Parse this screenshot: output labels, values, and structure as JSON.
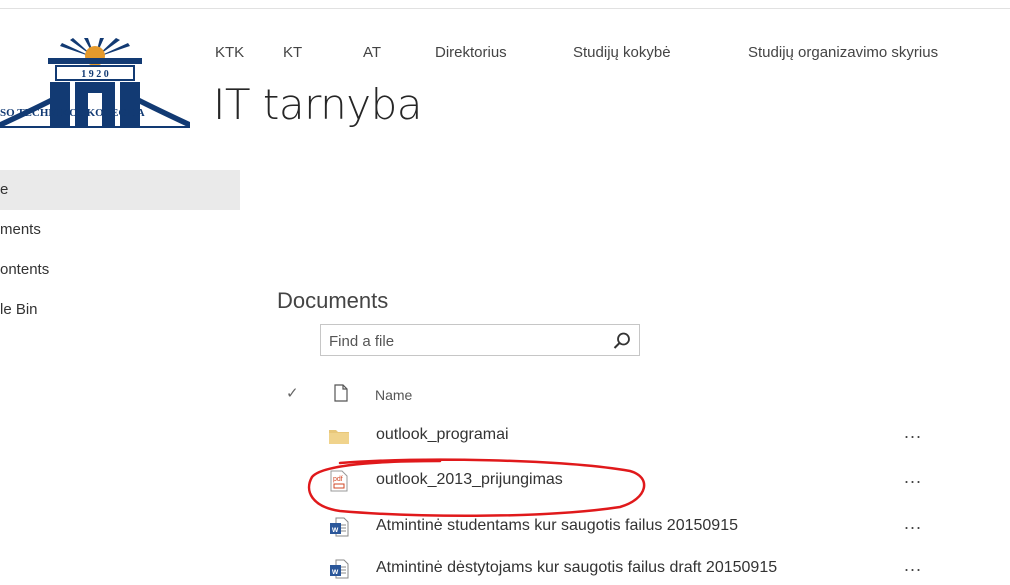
{
  "logo": {
    "year": "1 9 2 0",
    "text": "SO TECHNIKOS KOLEGIJA",
    "icon": "college-logo"
  },
  "top_nav": [
    "KTK",
    "KT",
    "AT",
    "Direktorius",
    "Studijų kokybė",
    "Studijų organizavimo skyrius"
  ],
  "site_title": "IT tarnyba",
  "left_nav": [
    {
      "label": "e",
      "selected": true
    },
    {
      "label": "ments",
      "selected": false
    },
    {
      "label": "ontents",
      "selected": false
    },
    {
      "label": "le Bin",
      "selected": false
    }
  ],
  "webpart": {
    "title": "Documents",
    "search_placeholder": "Find a file",
    "search_icon": "search-icon"
  },
  "list": {
    "header_name": "Name",
    "rows": [
      {
        "name": "outlook_programai",
        "icon": "folder-icon",
        "more": "..."
      },
      {
        "name": "outlook_2013_prijungimas",
        "icon": "pdf-icon",
        "more": "..."
      },
      {
        "name": "Atmintinė studentams kur saugotis failus 20150915",
        "icon": "word-icon",
        "more": "..."
      },
      {
        "name": "Atmintinė dėstytojams kur saugotis failus draft 20150915",
        "icon": "word-icon",
        "more": "..."
      }
    ]
  },
  "colors": {
    "annotation": "#e0191b",
    "word": "#2b579a",
    "pdf": "#d24726",
    "folder": "#e8c77a",
    "logo": "#123a73"
  }
}
